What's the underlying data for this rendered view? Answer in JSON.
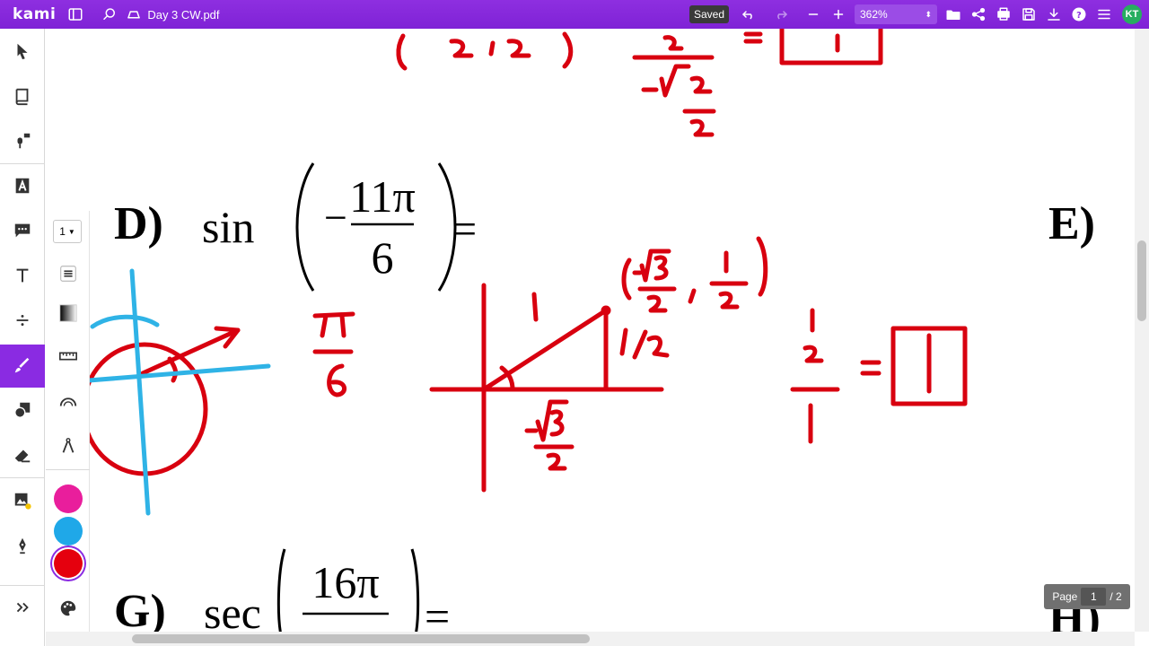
{
  "topbar": {
    "logo": "kami",
    "filename": "Day 3 CW.pdf",
    "saved": "Saved",
    "zoom": "362%",
    "avatar": "KT"
  },
  "subpanel": {
    "stroke_width": "1",
    "colors": [
      "#e91e9c",
      "#1fa8e8",
      "#e5000e"
    ]
  },
  "document": {
    "problem_d_label": "D)",
    "problem_d_func": "sin",
    "problem_d_num": "11π",
    "problem_d_den": "6",
    "problem_e_label": "E)",
    "problem_g_label": "G)",
    "problem_g_func": "sec",
    "problem_g_num": "16π",
    "problem_h_label": "H)",
    "equals": "=",
    "minus": "−"
  },
  "page": {
    "label": "Page",
    "current": "1",
    "total": "/ 2"
  }
}
